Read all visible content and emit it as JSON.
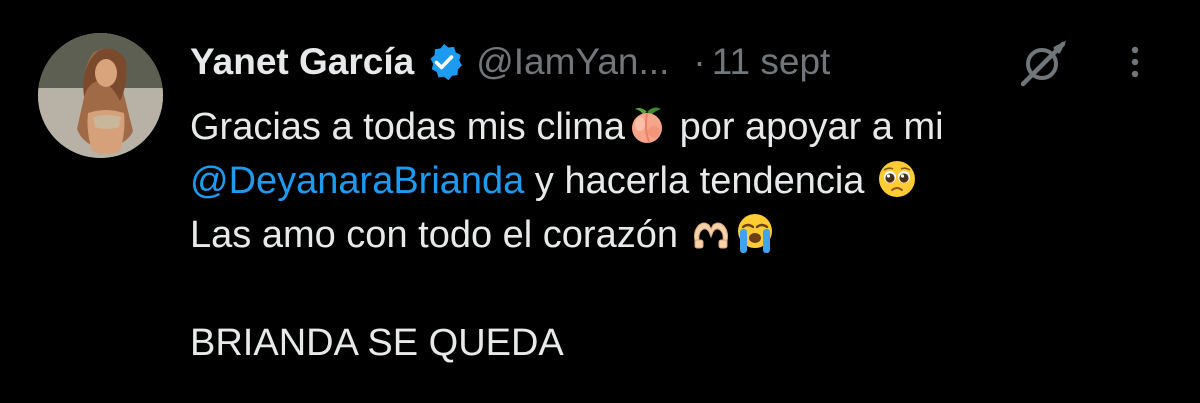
{
  "tweet": {
    "author": {
      "display_name": "Yanet García",
      "handle": "@IamYan...",
      "verified": true
    },
    "separator": "·",
    "timestamp": "11 sept",
    "lines": {
      "line1_a": "Gracias a todas mis clima",
      "line1_b": " por apoyar a mi",
      "line2_mention": "@DeyanaraBrianda",
      "line2_b": " y hacerla tendencia ",
      "line3_a": "Las amo con todo el corazón ",
      "line4": "BRIANDA SE QUEDA"
    },
    "emojis": [
      "peach-emoji",
      "pleading-face-emoji",
      "heart-hands-emoji",
      "loudly-crying-face-emoji"
    ]
  },
  "icons": {
    "verified": "verified-badge-icon",
    "grok": "grok-icon",
    "more": "more-options-icon"
  },
  "colors": {
    "background": "#000000",
    "text": "#e7e9ea",
    "secondary": "#71767b",
    "link": "#1d9bf0",
    "verified": "#1d9bf0"
  }
}
